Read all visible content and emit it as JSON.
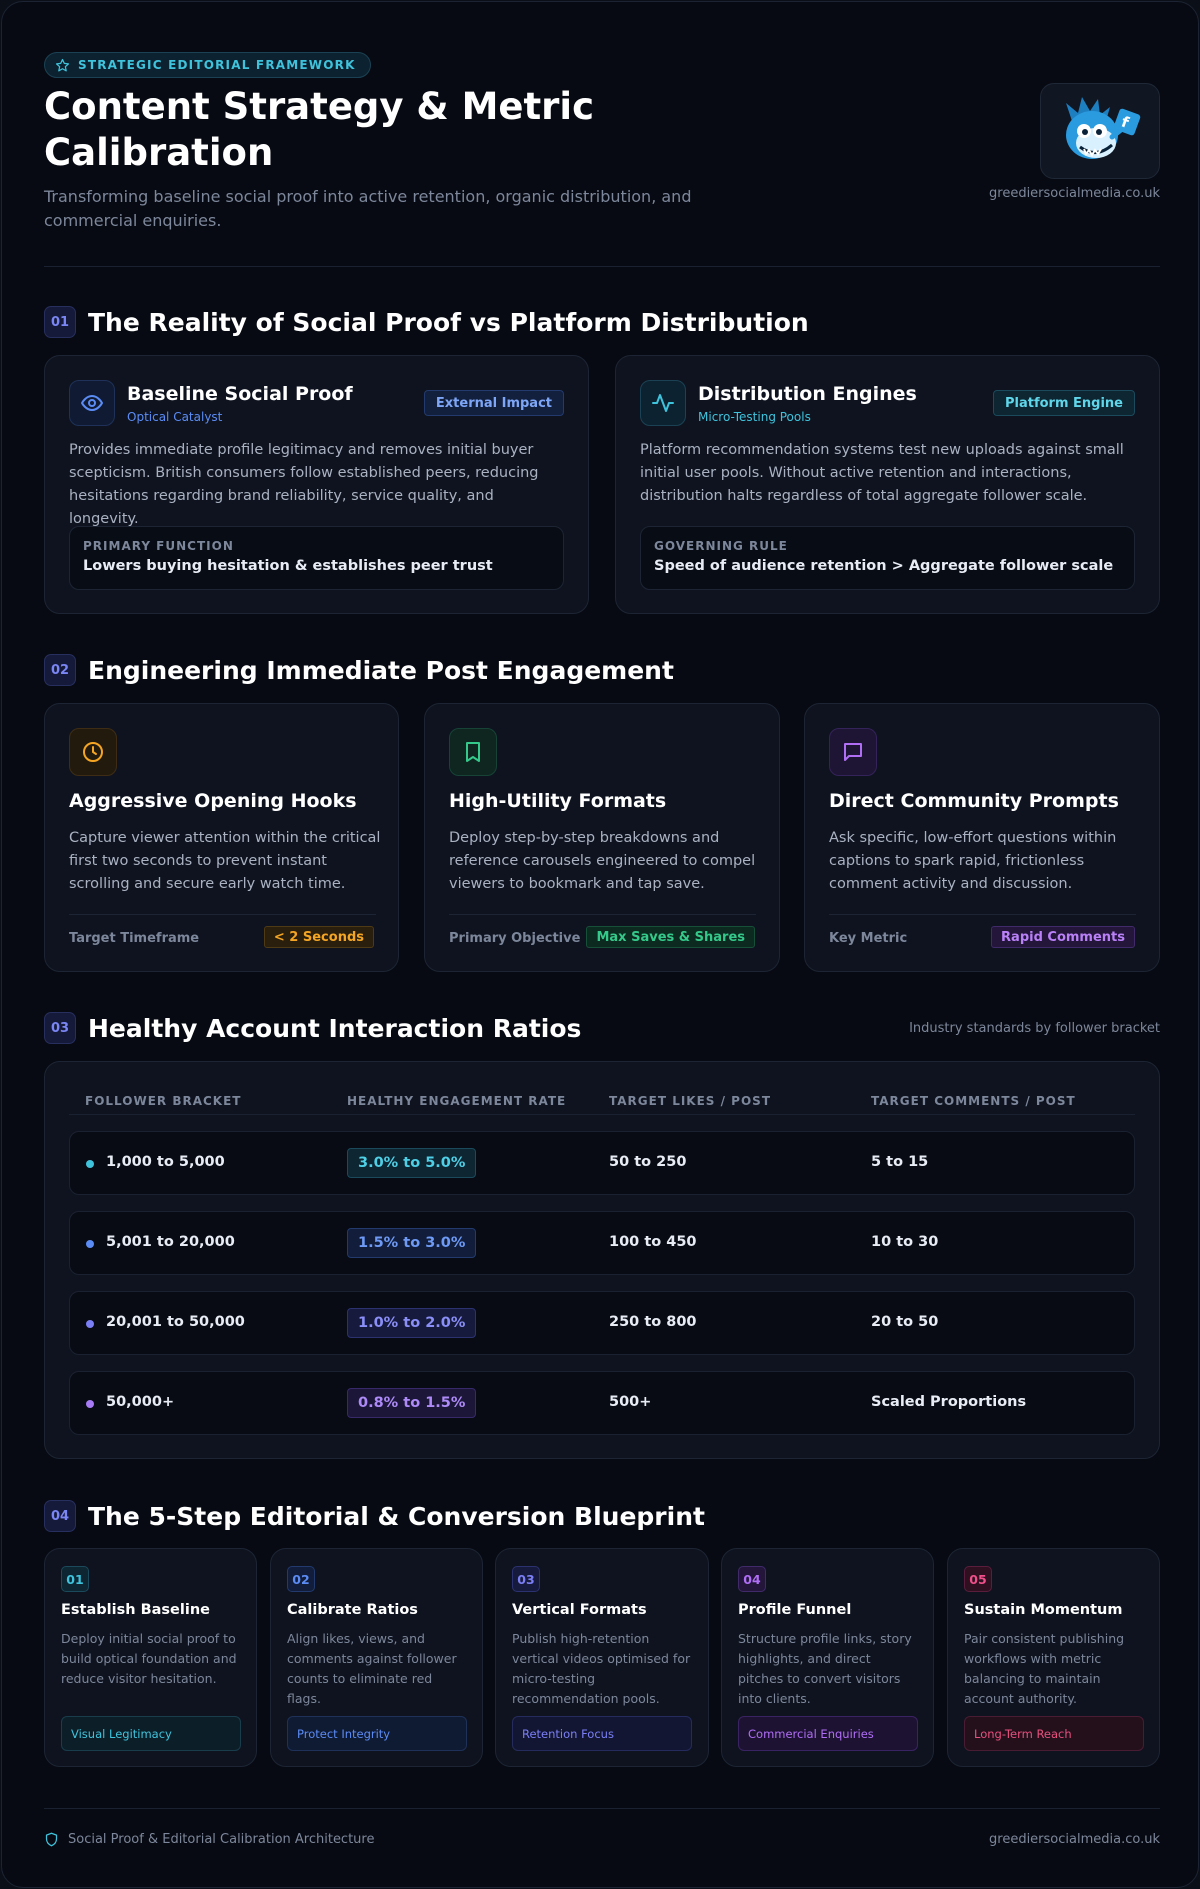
{
  "header": {
    "pill": "STRATEGIC EDITORIAL FRAMEWORK",
    "title": "Content Strategy & Metric Calibration",
    "subtitle": "Transforming baseline social proof into active retention, organic distribution, and commercial enquiries.",
    "domain": "greediersocialmedia.co.uk",
    "logo_icon": "cartoon-mascot-logo"
  },
  "section1": {
    "num": "01",
    "title": "The Reality of Social Proof vs Platform Distribution",
    "cards": [
      {
        "icon": "eye-icon",
        "title": "Baseline Social Proof",
        "subtitle": "Optical Catalyst",
        "tag": "External Impact",
        "body": "Provides immediate profile legitimacy and removes initial buyer scepticism. British consumers follow established peers, reducing hesitations regarding brand reliability, service quality, and longevity.",
        "box_label": "PRIMARY FUNCTION",
        "box_value": "Lowers buying hesitation & establishes peer trust",
        "accent": "#5b8cf5"
      },
      {
        "icon": "pulse-icon",
        "title": "Distribution Engines",
        "subtitle": "Micro-Testing Pools",
        "tag": "Platform Engine",
        "body": "Platform recommendation systems test new uploads against small initial user pools. Without active retention and interactions, distribution halts regardless of total aggregate follower scale.",
        "box_label": "GOVERNING RULE",
        "box_value": "Speed of audience retention > Aggregate follower scale",
        "accent": "#3fc3dc"
      }
    ]
  },
  "section2": {
    "num": "02",
    "title": "Engineering Immediate Post Engagement",
    "cards": [
      {
        "icon": "clock-icon",
        "title": "Aggressive Opening Hooks",
        "body": "Capture viewer attention within the critical first two seconds to prevent instant scrolling and secure early watch time.",
        "label": "Target Timeframe",
        "badge": "< 2 Seconds",
        "accent": "#f5a524"
      },
      {
        "icon": "bookmark-icon",
        "title": "High-Utility Formats",
        "body": "Deploy step-by-step breakdowns and reference carousels engineered to compel viewers to bookmark and tap save.",
        "label": "Primary Objective",
        "badge": "Max Saves & Shares",
        "accent": "#34c98a"
      },
      {
        "icon": "chat-bubble-icon",
        "title": "Direct Community Prompts",
        "body": "Ask specific, low-effort questions within captions to spark rapid, frictionless comment activity and discussion.",
        "label": "Key Metric",
        "badge": "Rapid Comments",
        "accent": "#b06ef5"
      }
    ]
  },
  "section3": {
    "num": "03",
    "title": "Healthy Account Interaction Ratios",
    "note": "Industry standards by follower bracket",
    "headers": [
      "FOLLOWER BRACKET",
      "HEALTHY ENGAGEMENT RATE",
      "TARGET LIKES / POST",
      "TARGET COMMENTS / POST"
    ],
    "rows": [
      {
        "bracket": "1,000 to 5,000",
        "rate": "3.0% to 5.0%",
        "likes": "50 to 250",
        "comments": "5 to 15",
        "color": "#3fc3dc"
      },
      {
        "bracket": "5,001 to 20,000",
        "rate": "1.5% to 3.0%",
        "likes": "100 to 450",
        "comments": "10 to 30",
        "color": "#5b8cf5"
      },
      {
        "bracket": "20,001 to 50,000",
        "rate": "1.0% to 2.0%",
        "likes": "250 to 800",
        "comments": "20 to 50",
        "color": "#7b7ff5"
      },
      {
        "bracket": "50,000+",
        "rate": "0.8% to 1.5%",
        "likes": "500+",
        "comments": "Scaled Proportions",
        "color": "#a77bf5"
      }
    ]
  },
  "section4": {
    "num": "04",
    "title": "The 5-Step Editorial & Conversion Blueprint",
    "steps": [
      {
        "num": "01",
        "title": "Establish Baseline",
        "body": "Deploy initial social proof to build optical foundation and reduce visitor hesitation.",
        "tag": "Visual Legitimacy",
        "color": "#3fc3dc"
      },
      {
        "num": "02",
        "title": "Calibrate Ratios",
        "body": "Align likes, views, and comments against follower counts to eliminate red flags.",
        "tag": "Protect Integrity",
        "color": "#5b8cf5"
      },
      {
        "num": "03",
        "title": "Vertical Formats",
        "body": "Publish high-retention vertical videos optimised for micro-testing recommendation pools.",
        "tag": "Retention Focus",
        "color": "#7b7ff5"
      },
      {
        "num": "04",
        "title": "Profile Funnel",
        "body": "Structure profile links, story highlights, and direct pitches to convert visitors into clients.",
        "tag": "Commercial Enquiries",
        "color": "#b06ef5"
      },
      {
        "num": "05",
        "title": "Sustain Momentum",
        "body": "Pair consistent publishing workflows with metric balancing to maintain account authority.",
        "tag": "Long-Term Reach",
        "color": "#f0508a"
      }
    ]
  },
  "footer": {
    "left": "Social Proof & Editorial Calibration Architecture",
    "right": "greediersocialmedia.co.uk",
    "icon": "shield-icon"
  }
}
